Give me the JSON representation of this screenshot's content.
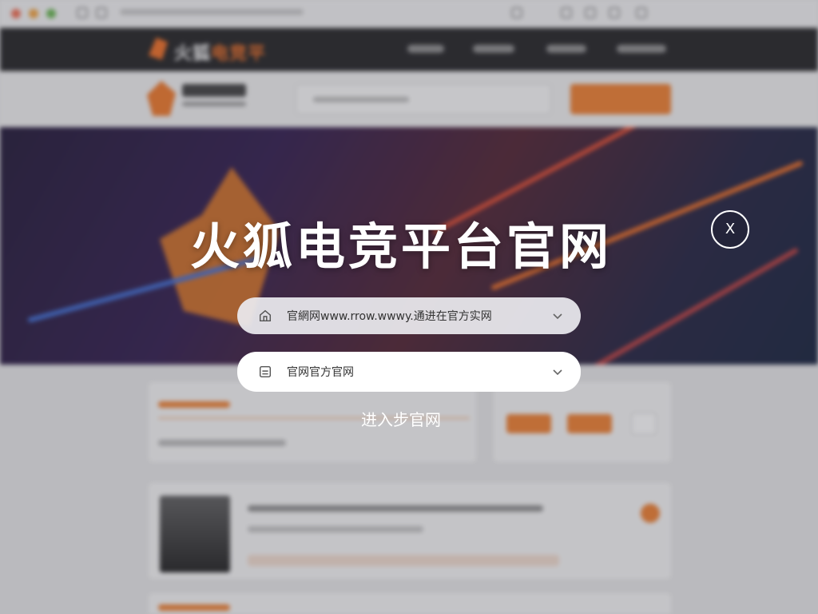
{
  "hero": {
    "title": "火狐电竞平台官网"
  },
  "close_button": {
    "label": "X"
  },
  "fields": [
    {
      "icon": "home-icon",
      "text": "官網网www.rrow.wwwy.通进在官方实网"
    },
    {
      "icon": "document-icon",
      "text": "官网官方官网"
    }
  ],
  "enter_link": {
    "label": "进入步官网"
  },
  "background": {
    "logo_text_white": "火狐",
    "logo_text_orange": "电竞平"
  },
  "colors": {
    "accent": "#ef7b29",
    "nav_bg": "#1c1c1e",
    "overlay_text": "#ffffff"
  }
}
